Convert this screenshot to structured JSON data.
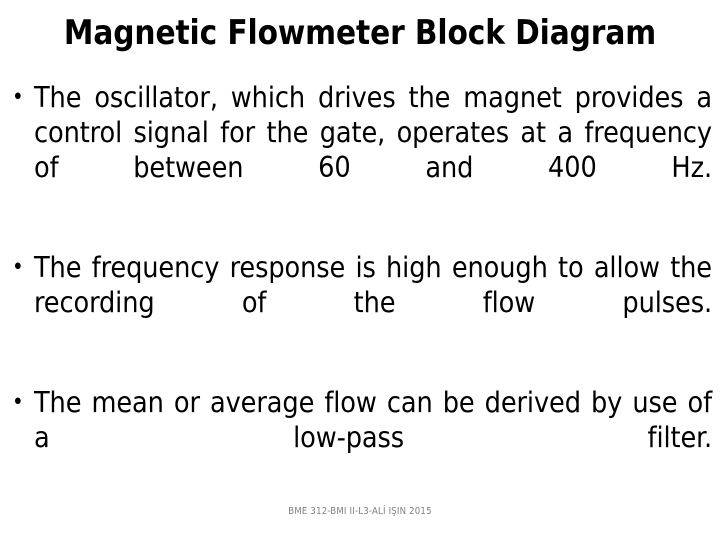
{
  "slide": {
    "title": "Magnetic Flowmeter Block Diagram",
    "bullet_marker": "•",
    "bullets": [
      {
        "text": "The oscillator, which drives the magnet provides a control signal for the gate, operates at a frequency of between 60 and 400 Hz."
      },
      {
        "text": "The frequency response is high enough to allow the recording of the flow pulses."
      },
      {
        "text": "The mean or average flow can be derived by use of a low-pass filter."
      }
    ],
    "footer": "BME 312-BMI II-L3-ALİ IŞIN 2015",
    "colors": {
      "background": "#FFFFFF",
      "text": "#000000",
      "footer_text": "#808080"
    }
  }
}
